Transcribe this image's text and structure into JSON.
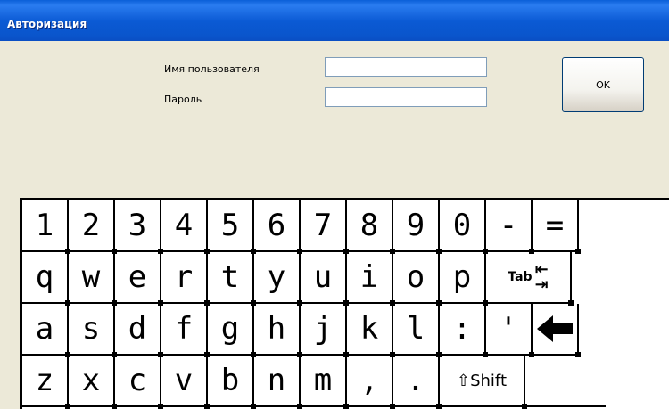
{
  "window": {
    "title": "Авторизация"
  },
  "form": {
    "username_label": "Имя пользователя",
    "username_value": "",
    "password_label": "Пароль",
    "password_value": "",
    "ok_label": "OK"
  },
  "keyboard": {
    "row1": [
      "1",
      "2",
      "3",
      "4",
      "5",
      "6",
      "7",
      "8",
      "9",
      "0",
      "-",
      "="
    ],
    "row2": [
      "q",
      "w",
      "e",
      "r",
      "t",
      "y",
      "u",
      "i",
      "o",
      "p"
    ],
    "row2_tab": "Tab",
    "row3": [
      "a",
      "s",
      "d",
      "f",
      "g",
      "h",
      "j",
      "k",
      "l",
      ":",
      "'"
    ],
    "row4": [
      "z",
      "x",
      "c",
      "v",
      "b",
      "n",
      "m",
      ",",
      "."
    ],
    "shift_label": "⇧Shift"
  },
  "icons": {
    "tab": "tab-arrows-icon",
    "backspace": "backspace-arrow-icon",
    "shift": "shift-arrow-icon"
  },
  "colors": {
    "titlebar": "#0a5fd8",
    "window_bg": "#ece9d8",
    "input_border": "#7f9db9",
    "button_border": "#003c74"
  }
}
